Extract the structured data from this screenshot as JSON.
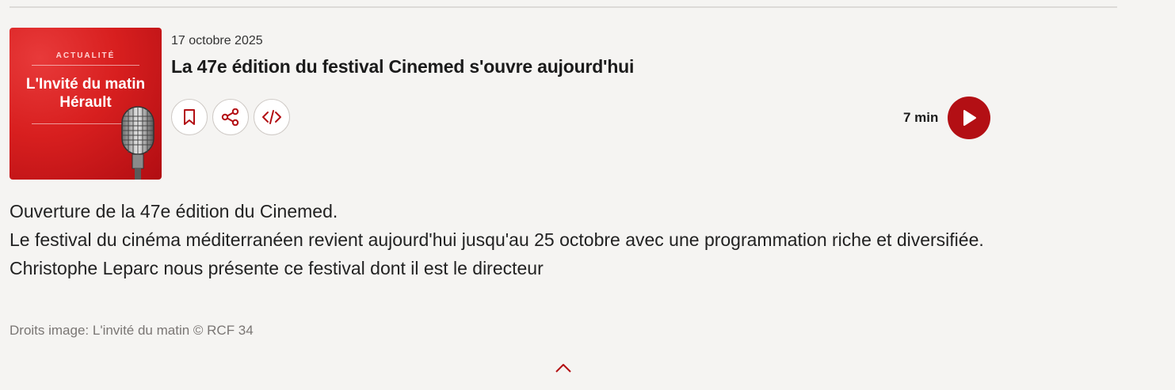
{
  "episode": {
    "cover": {
      "tag": "ACTUALITÉ",
      "title_line1": "L'Invité du matin",
      "title_line2": "Hérault"
    },
    "date": "17 octobre 2025",
    "title": "La 47e édition du festival Cinemed s'ouvre aujourd'hui",
    "duration": "7 min",
    "actions": {
      "bookmark_icon": "bookmark-icon",
      "share_icon": "share-icon",
      "embed_icon": "code-icon"
    },
    "description_lines": [
      "Ouverture de la 47e édition du Cinemed.",
      "Le festival du cinéma méditerranéen revient aujourd'hui jusqu'au 25 octobre avec une programmation riche et diversifiée.",
      "Christophe Leparc nous présente ce festival dont il est le directeur"
    ],
    "credit": "Droits image: L'invité du matin © RCF 34"
  },
  "colors": {
    "accent": "#b30f14",
    "background": "#f5f4f2",
    "cover_red": "#d81f1f"
  }
}
